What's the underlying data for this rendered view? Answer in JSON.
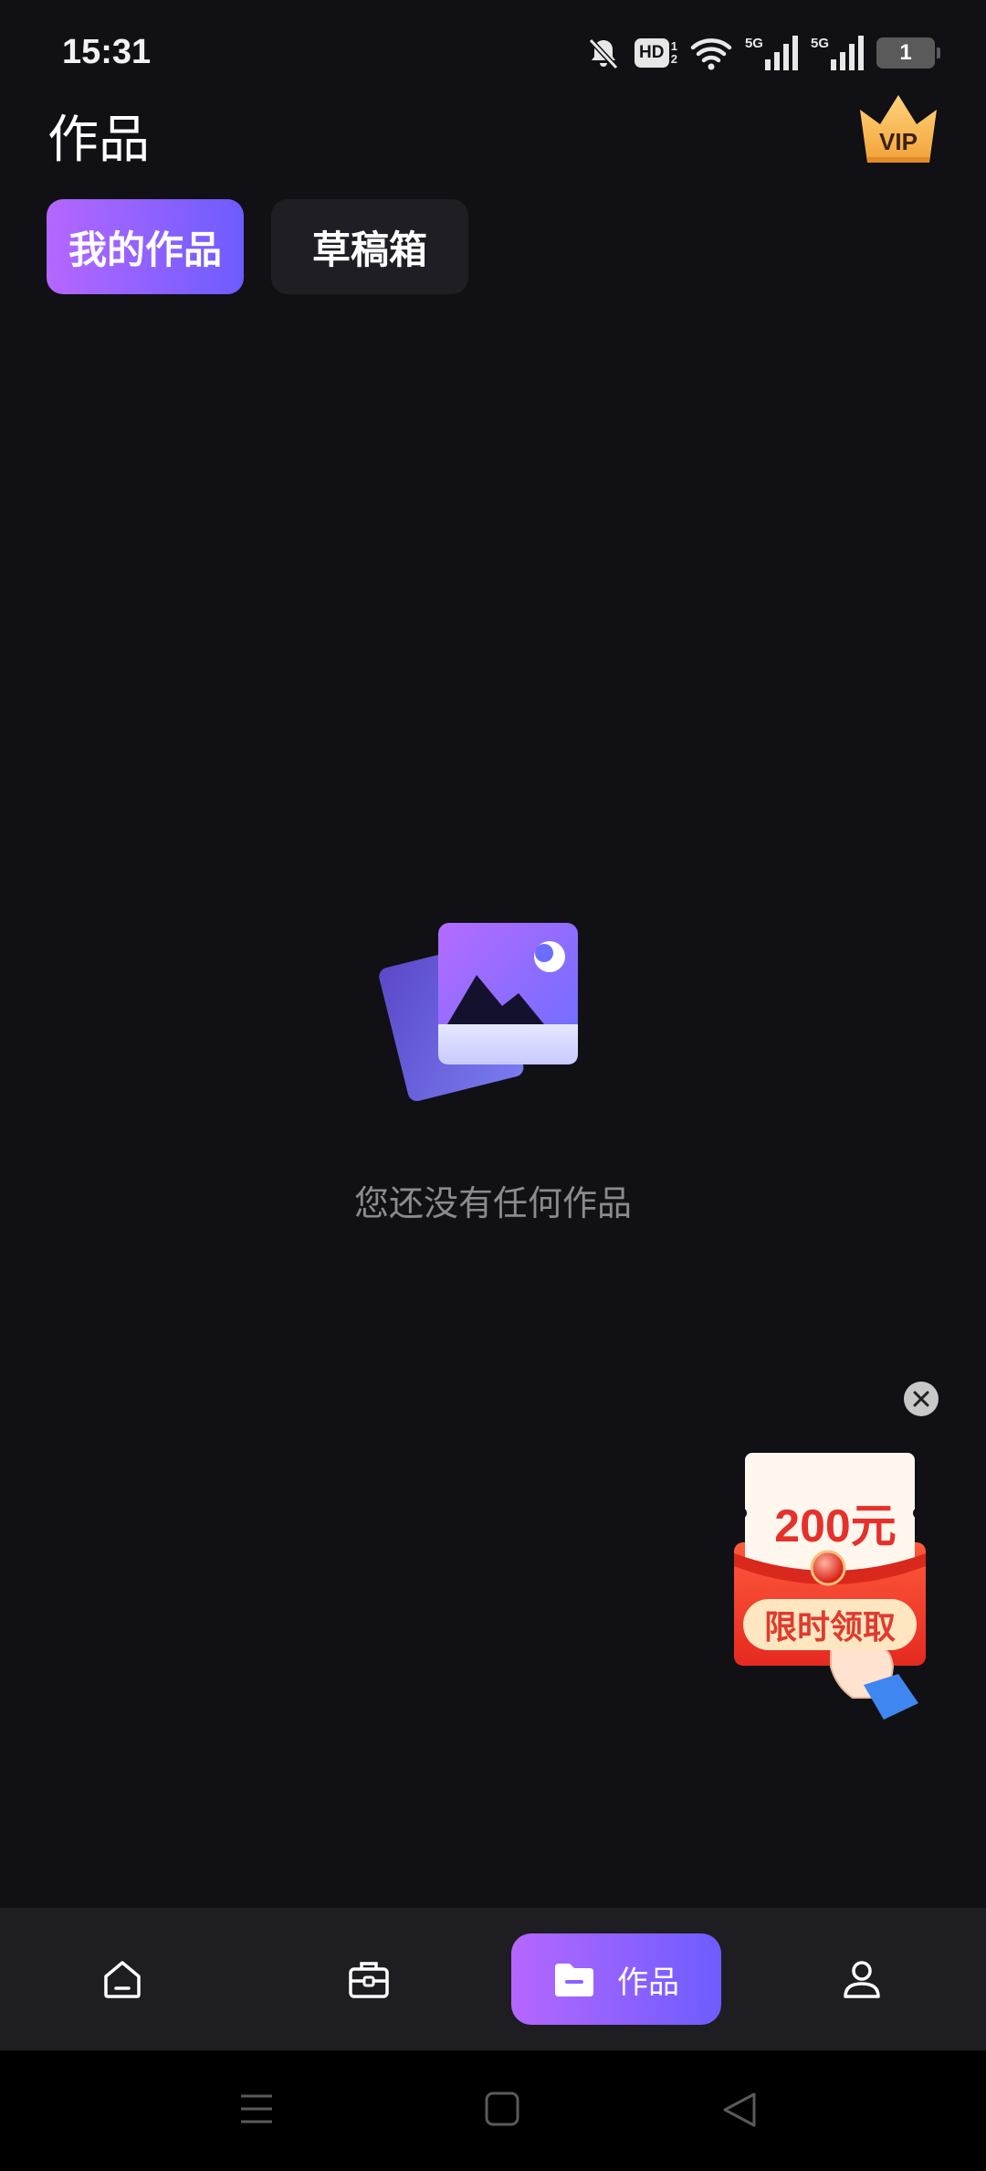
{
  "status_bar": {
    "time": "15:31",
    "hd_label": "HD",
    "hd_sub_top": "1",
    "hd_sub_bottom": "2",
    "signal_1_label": "5G",
    "signal_2_label": "5G",
    "battery_level": "1"
  },
  "header": {
    "title": "作品",
    "vip_label": "VIP"
  },
  "tabs": [
    {
      "label": "我的作品",
      "active": true
    },
    {
      "label": "草稿箱",
      "active": false
    }
  ],
  "empty_state": {
    "message": "您还没有任何作品"
  },
  "promo": {
    "amount": "200元",
    "cta": "限时领取"
  },
  "bottom_nav": {
    "items": [
      {
        "icon": "home-icon",
        "label": ""
      },
      {
        "icon": "toolbox-icon",
        "label": ""
      },
      {
        "icon": "folder-icon",
        "label": "作品",
        "active": true
      },
      {
        "icon": "profile-icon",
        "label": ""
      }
    ]
  },
  "colors": {
    "background": "#101015",
    "accent_start": "#b567ff",
    "accent_end": "#6d5cff",
    "promo_red": "#e5312b"
  }
}
